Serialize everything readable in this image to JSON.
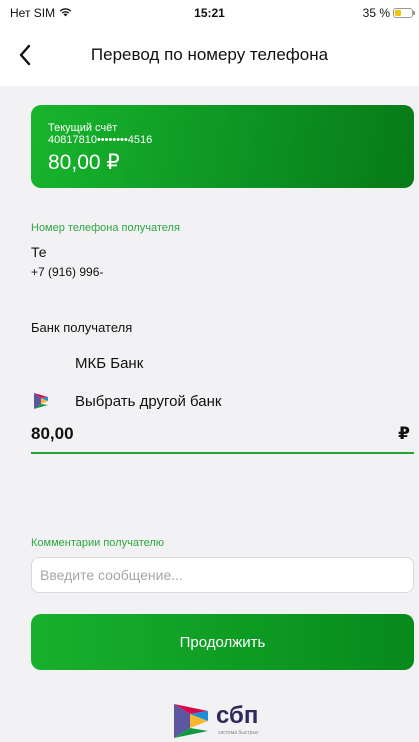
{
  "status_bar": {
    "carrier": "Нет SIM",
    "time": "15:21",
    "battery_percent": "35 %",
    "battery_level": 0.35
  },
  "nav": {
    "title": "Перевод по номеру телефона"
  },
  "account_card": {
    "label": "Текущий счёт",
    "number": "40817810••••••••4516",
    "amount": "80,00 ₽"
  },
  "phone": {
    "label": "Номер телефона получателя",
    "name": "Те",
    "number": "+7 (916) 996-"
  },
  "bank": {
    "label": "Банк получателя",
    "selected": "МКБ Банк",
    "choose_other": "Выбрать другой банк"
  },
  "amount": {
    "value": "80,00",
    "currency": "₽"
  },
  "comment": {
    "label": "Комментарии получателю",
    "placeholder": "Введите сообщение..."
  },
  "continue_label": "Продолжить",
  "footer_logo": {
    "word": "сбп",
    "subtitle": "система быстрых"
  }
}
